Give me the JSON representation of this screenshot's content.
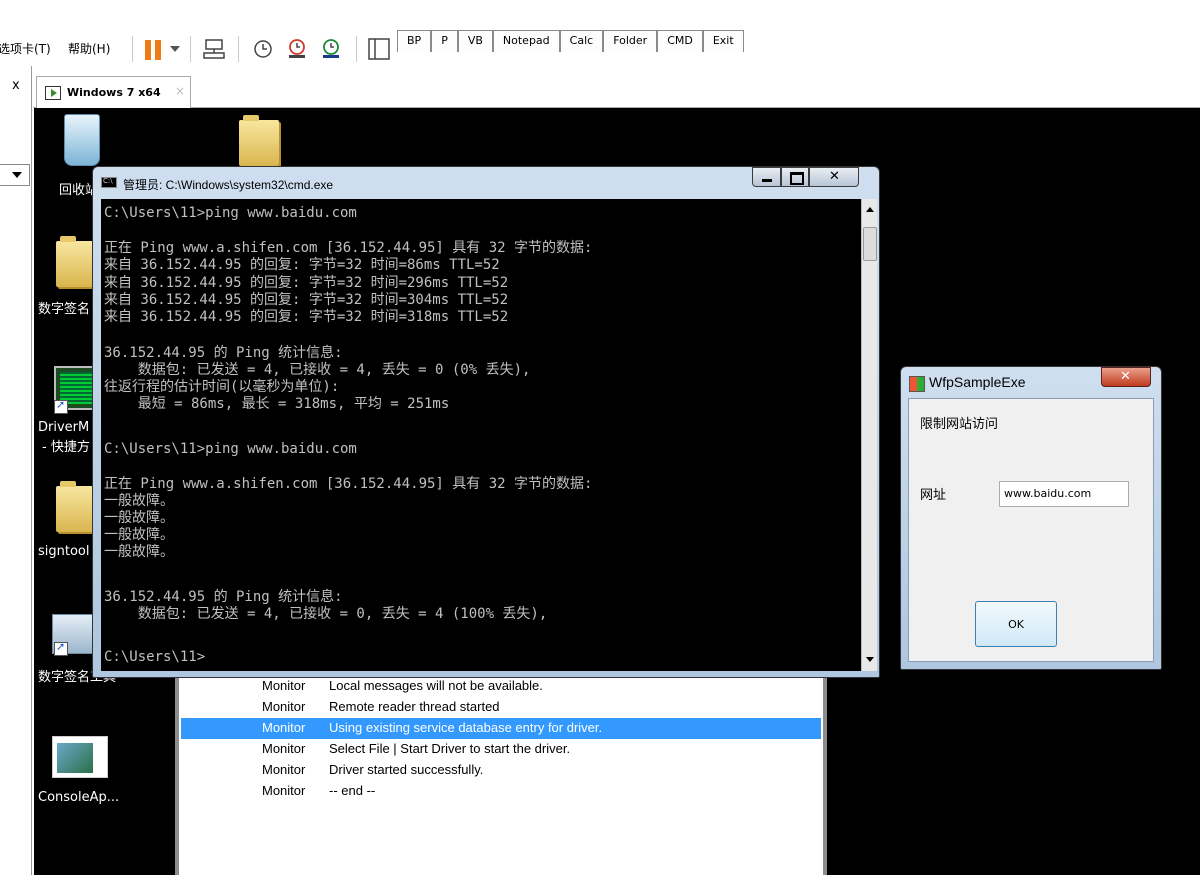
{
  "host": {
    "menu": [
      {
        "label": "选项卡(T)"
      },
      {
        "label": "帮助(H)"
      }
    ],
    "quick_buttons": [
      "BP",
      "P",
      "VB",
      "Notepad",
      "Calc",
      "Folder",
      "CMD",
      "Exit"
    ],
    "sidebar_close": "x",
    "vm_tab": "Windows 7 x64",
    "vm_tab_close": "×"
  },
  "desktop": {
    "icons": [
      {
        "label": "回收站",
        "icon": "recycle-bin-icon"
      },
      {
        "label": "数字签名",
        "icon": "folder-icon"
      },
      {
        "label": "DriverM",
        "icon": "app-icon"
      },
      {
        "label": "- 快捷方",
        "icon": "shortcut-icon"
      },
      {
        "label": "signtool",
        "icon": "folder-icon"
      },
      {
        "label": "数字签名工具",
        "icon": "certificate-icon"
      },
      {
        "label": "ConsoleAp...",
        "icon": "console-app-icon"
      }
    ]
  },
  "log_window": {
    "rows": [
      {
        "source": "Monitor",
        "message": "Local messages will not be available.",
        "selected": false
      },
      {
        "source": "Monitor",
        "message": "Remote reader thread started",
        "selected": false
      },
      {
        "source": "Monitor",
        "message": "Using existing service database entry for driver.",
        "selected": true
      },
      {
        "source": "Monitor",
        "message": "Select File | Start Driver to start the driver.",
        "selected": false
      },
      {
        "source": "Monitor",
        "message": "Driver started successfully.",
        "selected": false
      },
      {
        "source": "Monitor",
        "message": " -- end --",
        "selected": false
      }
    ]
  },
  "cmd_window": {
    "title": "管理员: C:\\Windows\\system32\\cmd.exe",
    "lines": [
      "C:\\Users\\11>ping www.baidu.com",
      "",
      "正在 Ping www.a.shifen.com [36.152.44.95] 具有 32 字节的数据:",
      "来自 36.152.44.95 的回复: 字节=32 时间=86ms TTL=52",
      "来自 36.152.44.95 的回复: 字节=32 时间=296ms TTL=52",
      "来自 36.152.44.95 的回复: 字节=32 时间=304ms TTL=52",
      "来自 36.152.44.95 的回复: 字节=32 时间=318ms TTL=52",
      "",
      "36.152.44.95 的 Ping 统计信息:",
      "    数据包: 已发送 = 4, 已接收 = 4, 丢失 = 0 (0% 丢失),",
      "往返行程的估计时间(以毫秒为单位):",
      "    最短 = 86ms, 最长 = 318ms, 平均 = 251ms",
      "",
      "C:\\Users\\11>ping www.baidu.com",
      "",
      "正在 Ping www.a.shifen.com [36.152.44.95] 具有 32 字节的数据:",
      "一般故障。",
      "一般故障。",
      "一般故障。",
      "一般故障。",
      "",
      "36.152.44.95 的 Ping 统计信息:",
      "    数据包: 已发送 = 4, 已接收 = 0, 丢失 = 4 (100% 丢失),",
      "",
      "C:\\Users\\11>"
    ]
  },
  "dialog": {
    "title": "WfpSampleExe",
    "heading": "限制网站访问",
    "url_label": "网址",
    "url_value": "www.baidu.com",
    "ok_label": "OK"
  }
}
